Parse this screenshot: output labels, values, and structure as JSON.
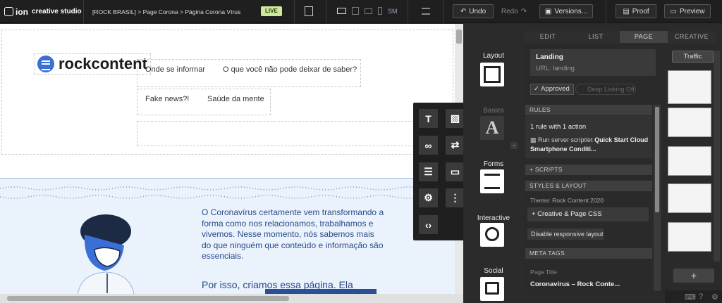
{
  "topbar": {
    "app": "ion",
    "studio": "creative studio",
    "breadcrumb": "[ROCK BRASIL] > Page Corona > Página Corona Vírus",
    "live": "LIVE",
    "device_sm": "SM",
    "undo": "Undo",
    "redo": "Redo",
    "versions": "Versions...",
    "proof": "Proof",
    "preview": "Preview"
  },
  "page": {
    "logo": "rockcontent",
    "nav": [
      "Onde se informar",
      "O que você não pode deixar de saber?",
      "Fake news?!",
      "Saúde da mente"
    ],
    "hero_text": "O Coronavírus certamente vem transformando a forma como nos relacionamos, trabalhamos e vivemos. Nesse momento, nós sabemos mais do que ninguém que conteúdo e informação são essenciais.",
    "hero_text2": "Por isso, criamos essa página. Ela"
  },
  "categories": {
    "layout": "Layout",
    "basics": "Basics",
    "forms": "Forms",
    "interactive": "Interactive",
    "social": "Social"
  },
  "tabs": [
    "EDIT",
    "LIST",
    "PAGE",
    "CREATIVE"
  ],
  "panel": {
    "landing_title": "Landing",
    "landing_url": "URL: landing",
    "approved": "Approved",
    "deep_linking": "Deep Linking Off",
    "rules_header": "RULES",
    "rule_count": "1 rule with 1 action",
    "rule_prefix": "Run server scriptlet",
    "rule_name": "Quick Start Cloud Smartphone Conditi...",
    "scripts": "+ SCRIPTS",
    "styles_header": "STYLES & LAYOUT",
    "theme": "Theme: Rock Content 2020",
    "creative_css": "+ Creative & Page CSS",
    "disable_responsive": "Disable responsive layout",
    "meta_header": "META TAGS",
    "page_title_label": "Page Title",
    "page_title_value": "Coronavírus – Rock Conte..."
  },
  "creative": {
    "traffic": "Traffic",
    "add": "+"
  }
}
